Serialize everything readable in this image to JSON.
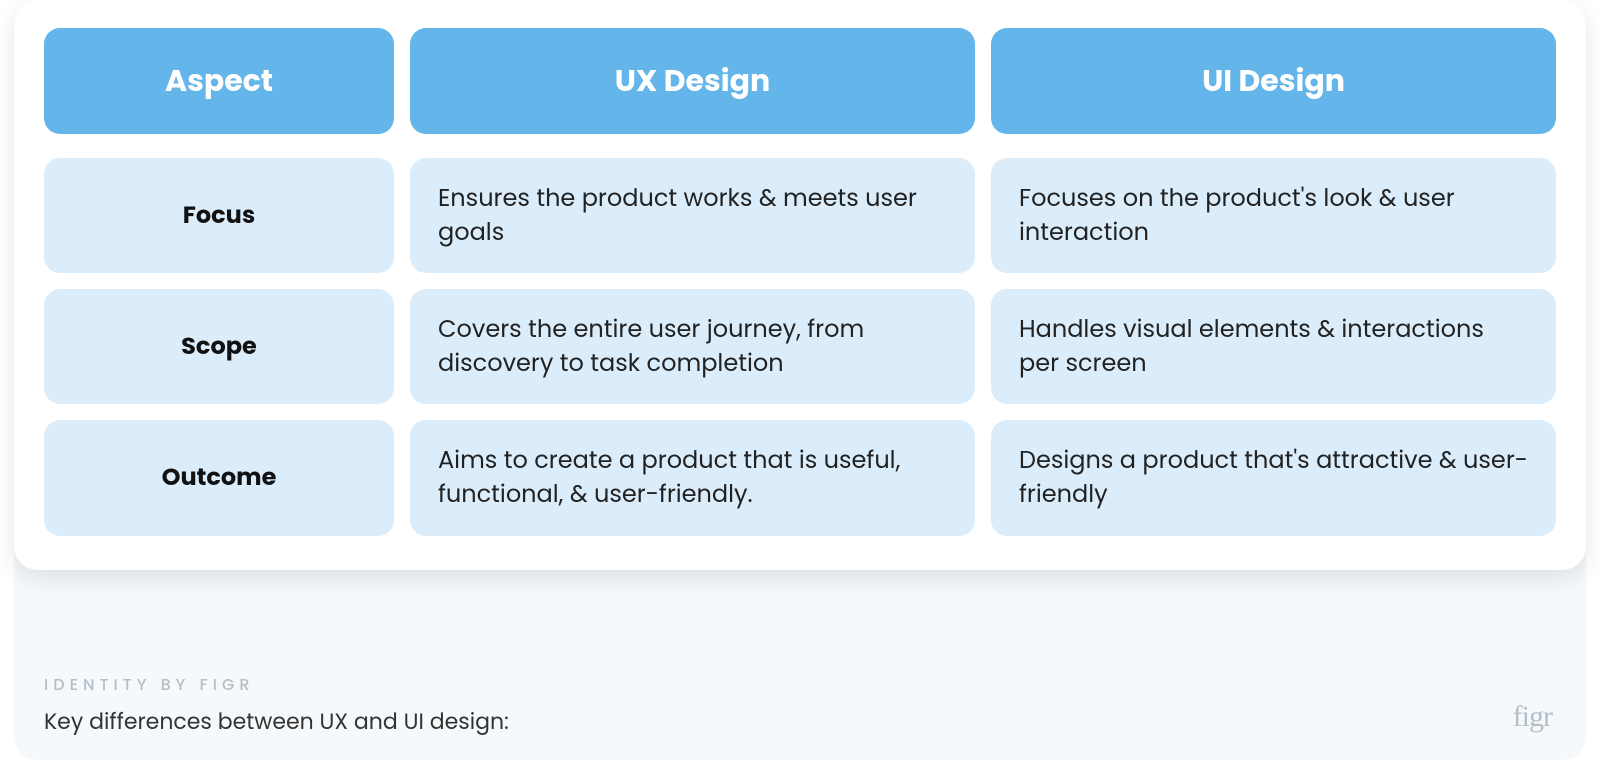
{
  "table": {
    "headers": [
      "Aspect",
      "UX Design",
      "UI Design"
    ],
    "rows": [
      {
        "aspect": "Focus",
        "ux": "Ensures the product works & meets user goals",
        "ui": "Focuses on the product's look & user interaction"
      },
      {
        "aspect": "Scope",
        "ux": "Covers the entire user journey, from discovery to task completion",
        "ui": "Handles visual elements & interactions per screen"
      },
      {
        "aspect": "Outcome",
        "ux": "Aims to create a product that is useful, functional, & user-friendly.",
        "ui": "Designs a product that's attractive & user-friendly"
      }
    ]
  },
  "footer": {
    "identity": "IDENTITY BY FIGR",
    "caption": "Key differences between UX and UI design:",
    "brand": "figr"
  },
  "colors": {
    "header_bg": "#64b6ea",
    "cell_bg": "#dbedfb",
    "panel_bg": "#f5f9fb"
  }
}
